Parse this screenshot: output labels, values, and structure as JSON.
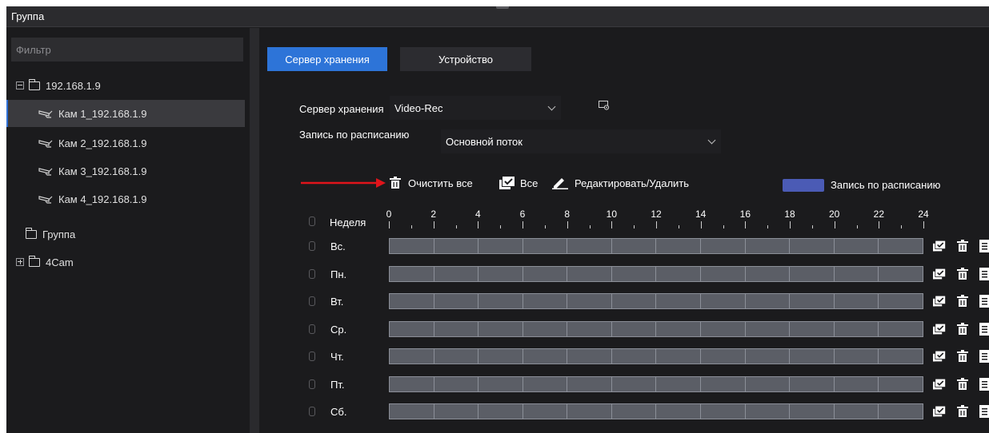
{
  "window": {
    "title": "Группа"
  },
  "filter": {
    "placeholder": "Фильтр"
  },
  "tree": [
    {
      "label": "192.168.1.9",
      "kind": "folder-expanded"
    },
    {
      "label": "Кам 1_192.168.1.9",
      "kind": "camera",
      "selected": true
    },
    {
      "label": "Кам 2_192.168.1.9",
      "kind": "camera"
    },
    {
      "label": "Кам 3_192.168.1.9",
      "kind": "camera"
    },
    {
      "label": "Кам 4_192.168.1.9",
      "kind": "camera"
    },
    {
      "label": "Группа",
      "kind": "folder"
    },
    {
      "label": "4Cam",
      "kind": "folder-collapsed"
    }
  ],
  "tabs": {
    "storage": "Сервер хранения",
    "device": "Устройство"
  },
  "form": {
    "server_label": "Сервер хранения",
    "server_value": "Video-Rec",
    "schedule_label": "Запись по расписанию",
    "stream_value": "Основной поток"
  },
  "toolbar": {
    "clear_all": "Очистить все",
    "all": "Все",
    "edit_delete": "Редактировать/Удалить"
  },
  "legend": {
    "label": "Запись по расписанию",
    "color": "#4b5bb5"
  },
  "schedule": {
    "week_label": "Неделя",
    "hours": [
      "0",
      "2",
      "4",
      "6",
      "8",
      "10",
      "12",
      "14",
      "16",
      "18",
      "20",
      "22",
      "24"
    ],
    "days": [
      "Вс.",
      "Пн.",
      "Вт.",
      "Ср.",
      "Чт.",
      "Пт.",
      "Сб."
    ]
  },
  "colors": {
    "accent": "#2d74d8",
    "arrow": "#e0141b"
  },
  "icons": [
    "settings-icon",
    "trash-icon",
    "select-all-icon",
    "pencil-icon",
    "lock-icon",
    "copy-icon",
    "camera-icon",
    "folder-icon"
  ]
}
